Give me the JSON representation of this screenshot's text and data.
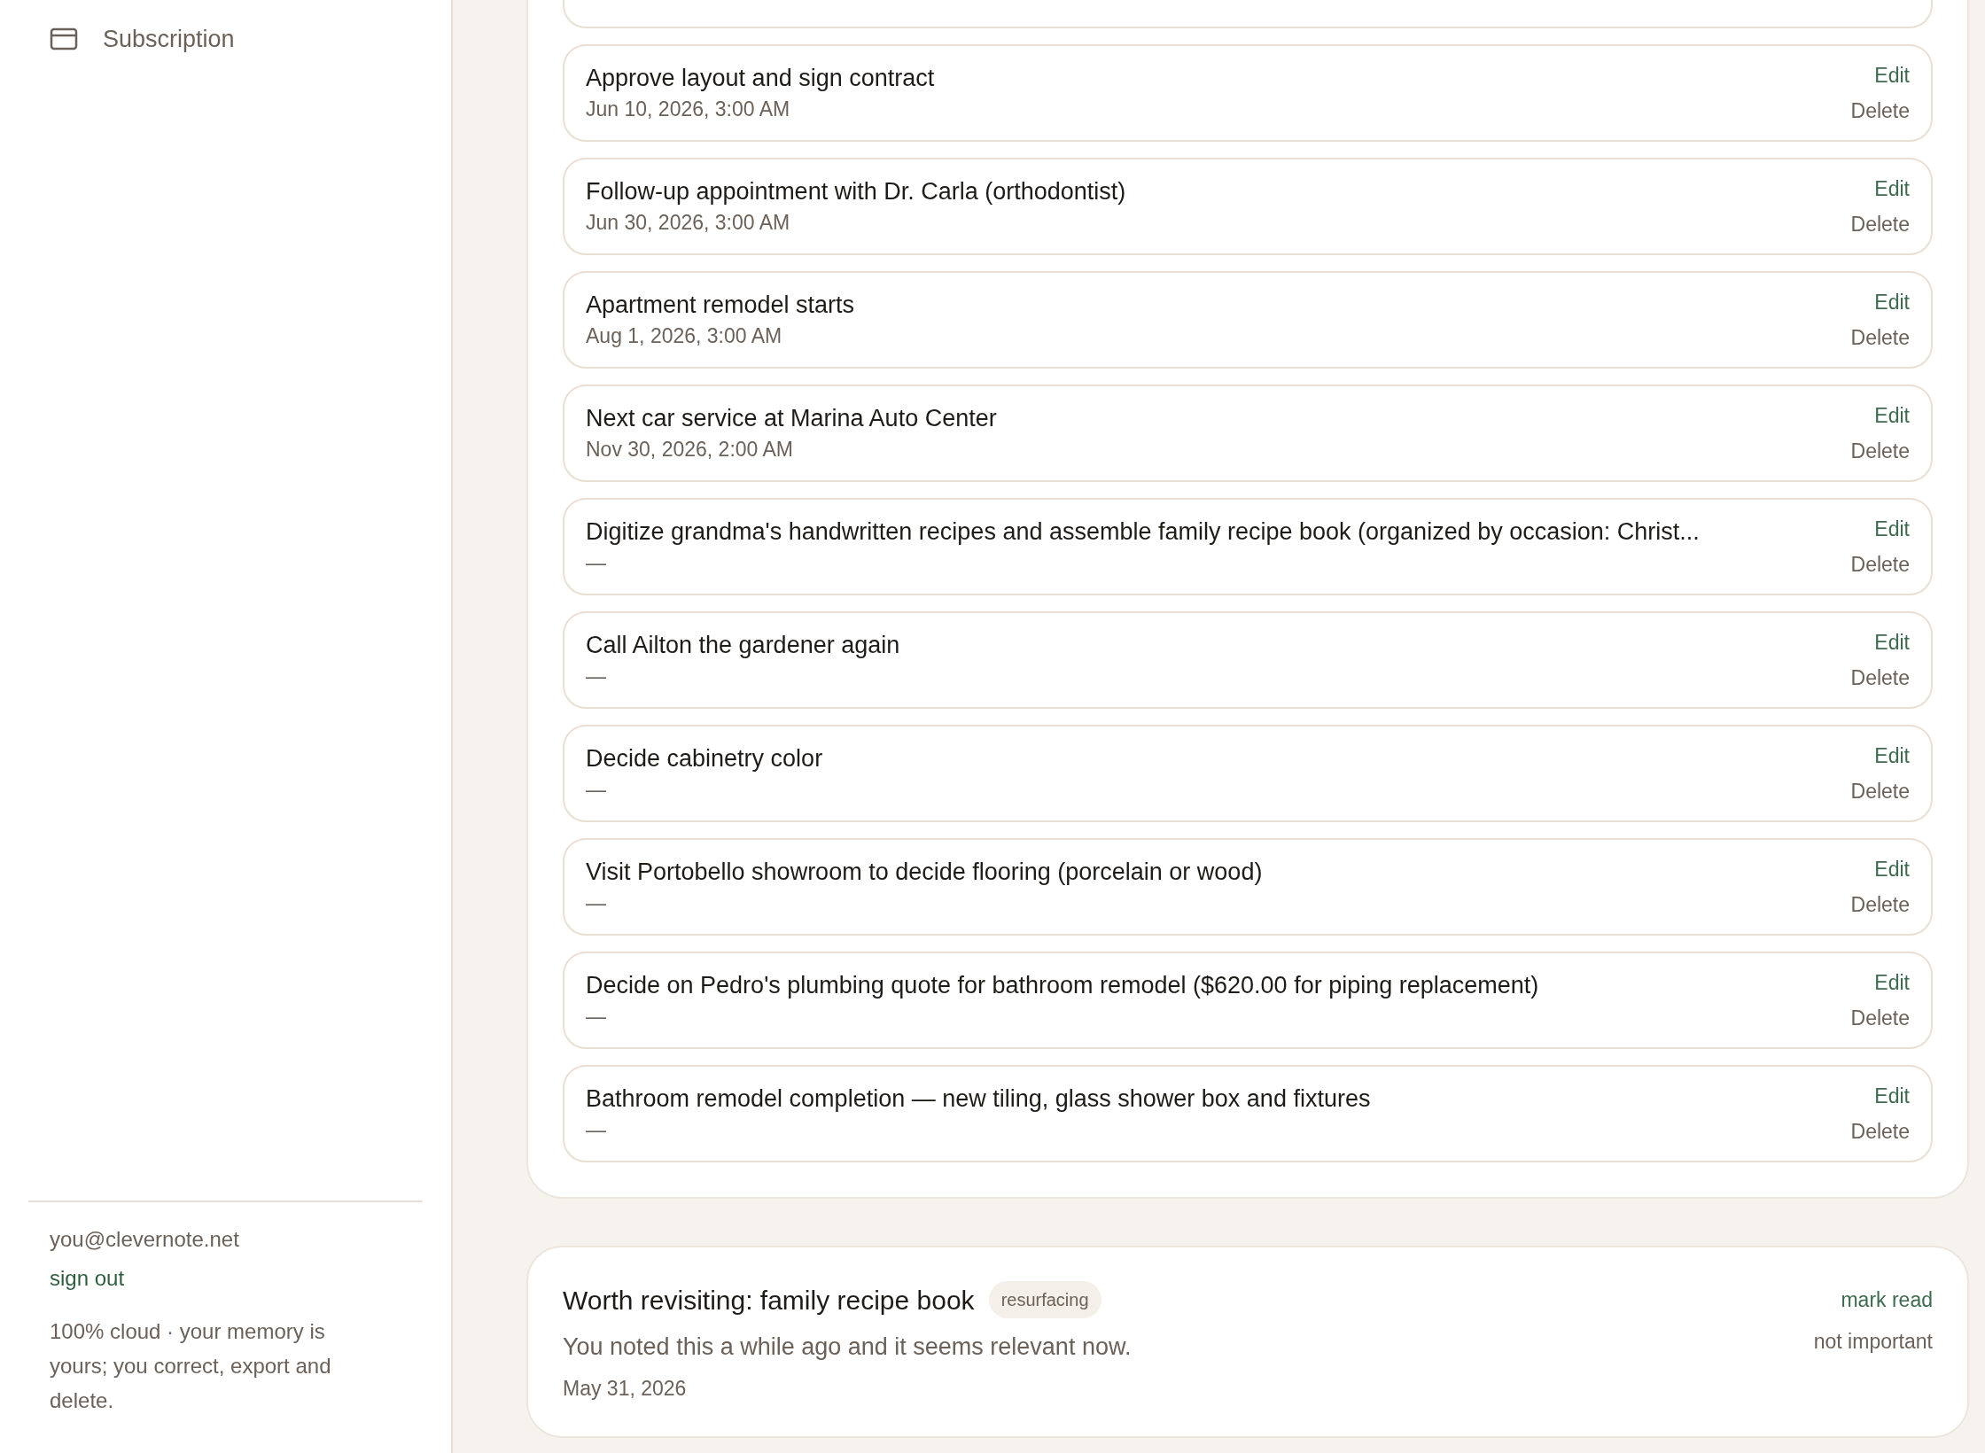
{
  "sidebar": {
    "nav_items": [
      {
        "label": "Subscription"
      }
    ],
    "account": {
      "email": "you@clevernote.net",
      "sign_out": "sign out"
    },
    "note": "100% cloud · your memory is yours; you correct, export and delete."
  },
  "reminders": [
    {
      "title": "Approve layout and sign contract",
      "date": "Jun 10, 2026, 3:00 AM",
      "edit": "Edit",
      "delete": "Delete"
    },
    {
      "title": "Follow-up appointment with Dr. Carla (orthodontist)",
      "date": "Jun 30, 2026, 3:00 AM",
      "edit": "Edit",
      "delete": "Delete"
    },
    {
      "title": "Apartment remodel starts",
      "date": "Aug 1, 2026, 3:00 AM",
      "edit": "Edit",
      "delete": "Delete"
    },
    {
      "title": "Next car service at Marina Auto Center",
      "date": "Nov 30, 2026, 2:00 AM",
      "edit": "Edit",
      "delete": "Delete"
    },
    {
      "title": "Digitize grandma's handwritten recipes and assemble family recipe book (organized by occasion: Christ...",
      "date": "—",
      "edit": "Edit",
      "delete": "Delete"
    },
    {
      "title": "Call Ailton the gardener again",
      "date": "—",
      "edit": "Edit",
      "delete": "Delete"
    },
    {
      "title": "Decide cabinetry color",
      "date": "—",
      "edit": "Edit",
      "delete": "Delete"
    },
    {
      "title": "Visit Portobello showroom to decide flooring (porcelain or wood)",
      "date": "—",
      "edit": "Edit",
      "delete": "Delete"
    },
    {
      "title": "Decide on Pedro's plumbing quote for bathroom remodel ($620.00 for piping replacement)",
      "date": "—",
      "edit": "Edit",
      "delete": "Delete"
    },
    {
      "title": "Bathroom remodel completion — new tiling, glass shower box and fixtures",
      "date": "—",
      "edit": "Edit",
      "delete": "Delete"
    }
  ],
  "insight": {
    "title": "Worth revisiting: family recipe book",
    "badge": "resurfacing",
    "body": "You noted this a while ago and it seems relevant now.",
    "date": "May 31, 2026",
    "actions": [
      "mark read",
      "not important"
    ]
  }
}
